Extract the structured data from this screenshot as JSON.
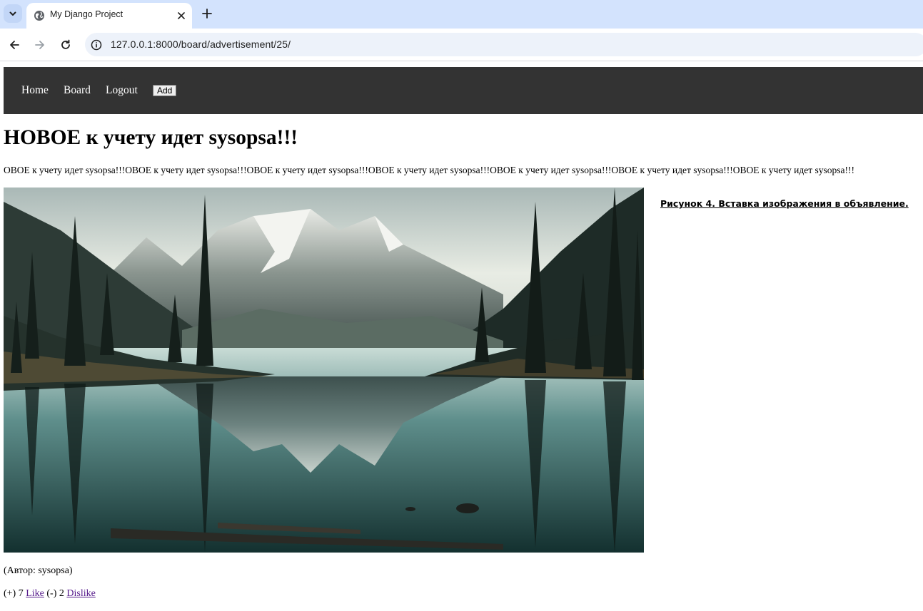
{
  "browser": {
    "tab_title": "My Django Project",
    "url": "127.0.0.1:8000/board/advertisement/25/"
  },
  "nav": {
    "home": "Home",
    "board": "Board",
    "logout": "Logout",
    "add": "Add"
  },
  "advertisement": {
    "title": "НОВОЕ к учету идет sysopsa!!!",
    "text": "ОВОЕ к учету идет sysopsa!!!ОВОЕ к учету идет sysopsa!!!ОВОЕ к учету идет sysopsa!!!ОВОЕ к учету идет sysopsa!!!ОВОЕ к учету идет sysopsa!!!ОВОЕ к учету идет sysopsa!!!ОВОЕ к учету идет sysopsa!!!",
    "caption": "Рисунок 4. Вставка изображения в объявление.",
    "author": "(Автор: sysopsa)"
  },
  "votes": {
    "plus_prefix": "(+)",
    "likes": "7",
    "like_label": "Like",
    "minus_prefix": "(-)",
    "dislikes": "2",
    "dislike_label": "Dislike"
  },
  "colors": {
    "tabstrip": "#d3e3fd",
    "navbar": "#333333",
    "visited_link": "#551a8b"
  }
}
